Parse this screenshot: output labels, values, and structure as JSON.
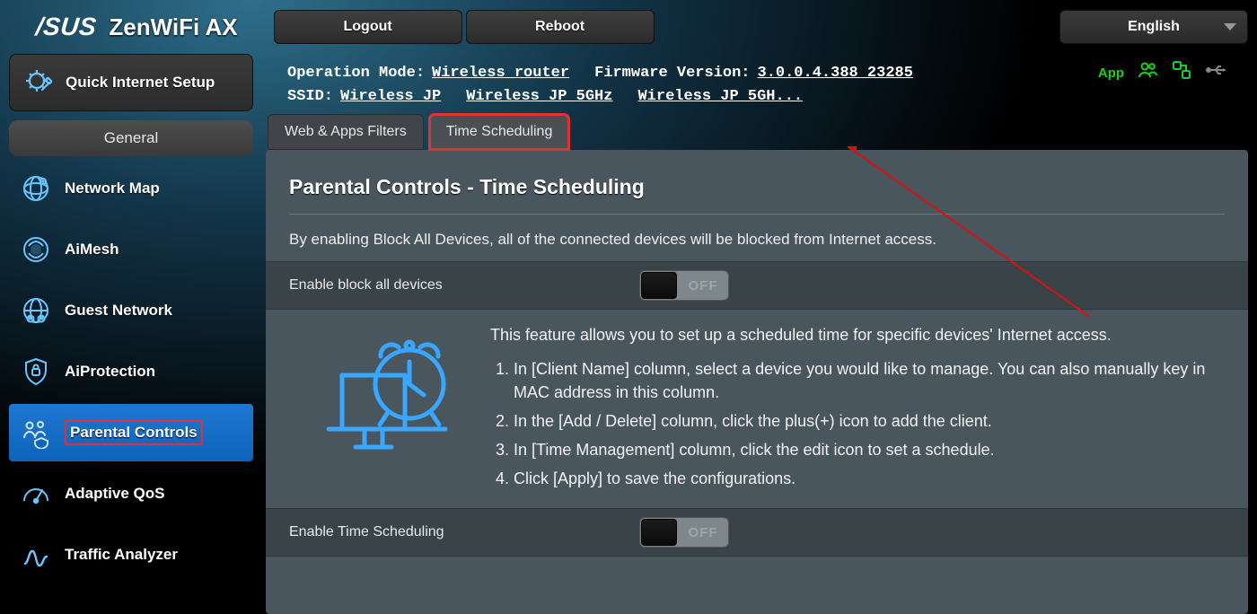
{
  "brand": {
    "logo": "/SUS",
    "model": "ZenWiFi AX"
  },
  "top": {
    "logout": "Logout",
    "reboot": "Reboot",
    "language": "English"
  },
  "status": {
    "op_mode_label": "Operation Mode:",
    "op_mode_value": "Wireless router",
    "fw_label": "Firmware Version:",
    "fw_value": "3.0.0.4.388_23285",
    "ssid_label": "SSID:",
    "ssid1": "Wireless JP",
    "ssid2": "Wireless JP 5GHz",
    "ssid3": "Wireless JP 5GH...",
    "app_label": "App"
  },
  "sidebar": {
    "qis": "Quick Internet Setup",
    "group": "General",
    "items": [
      {
        "label": "Network Map"
      },
      {
        "label": "AiMesh"
      },
      {
        "label": "Guest Network"
      },
      {
        "label": "AiProtection"
      },
      {
        "label": "Parental Controls"
      },
      {
        "label": "Adaptive QoS"
      },
      {
        "label": "Traffic Analyzer"
      }
    ]
  },
  "tabs": {
    "t1": "Web & Apps Filters",
    "t2": "Time Scheduling"
  },
  "panel": {
    "title": "Parental Controls - Time Scheduling",
    "desc": "By enabling Block All Devices, all of the connected devices will be blocked from Internet access.",
    "row1_label": "Enable block all devices",
    "toggle_off": "OFF",
    "feature_lead": "This feature allows you to set up a scheduled time for specific devices' Internet access.",
    "step1": "In [Client Name] column, select a device you would like to manage. You can also manually key in MAC address in this column.",
    "step2": "In the [Add / Delete] column, click the plus(+) icon to add the client.",
    "step3": "In [Time Management] column, click the edit icon to set a schedule.",
    "step4": "Click [Apply] to save the configurations.",
    "row2_label": "Enable Time Scheduling"
  }
}
